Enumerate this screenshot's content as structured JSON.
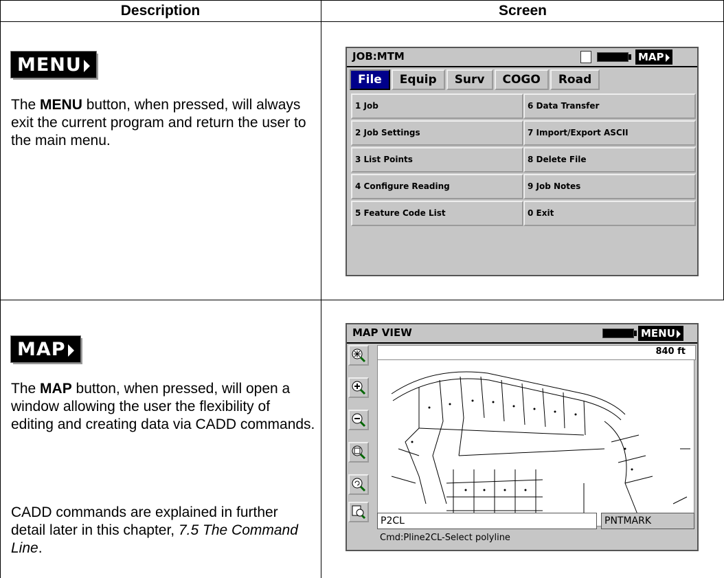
{
  "table": {
    "headers": {
      "description": "Description",
      "screen": "Screen"
    }
  },
  "rows": [
    {
      "button_label": "MENU",
      "desc_pre": "The ",
      "desc_bold": "MENU",
      "desc_post": " button, when pressed, will always exit the current program and return the user to the main menu.",
      "screen": {
        "title": "JOB:MTM",
        "top_button": "MAP",
        "tabs": [
          "File",
          "Equip",
          "Surv",
          "COGO",
          "Road"
        ],
        "menu_items": [
          "1 Job",
          "6 Data Transfer",
          "2 Job Settings",
          "7 Import/Export ASCII",
          "3 List Points",
          "8 Delete File",
          "4 Configure Reading",
          "9 Job Notes",
          "5 Feature Code List",
          "0 Exit"
        ]
      }
    },
    {
      "button_label": "MAP",
      "desc_pre": "The ",
      "desc_bold": "MAP",
      "desc_post": " button, when pressed, will open a window allowing the user the flexibility of editing and creating data via CADD commands.",
      "desc2": "CADD commands are explained in further detail later in this chapter, ",
      "desc2_italic": "7.5 The Command Line",
      "desc2_end": ".",
      "screen": {
        "title": "MAP VIEW",
        "top_button": "MENU",
        "scale": "840 ft",
        "tools": [
          "zoom-extents-icon",
          "zoom-in-icon",
          "zoom-out-icon",
          "zoom-window-icon",
          "zoom-previous-icon",
          "pan-icon"
        ],
        "cmd_input": "P2CL",
        "cmd_side": "PNTMARK",
        "cmd_status": "Cmd:Pline2CL-Select polyline"
      }
    }
  ],
  "colors": {
    "tab_active": "#00008b",
    "screen_bg": "#c6c6c6"
  }
}
